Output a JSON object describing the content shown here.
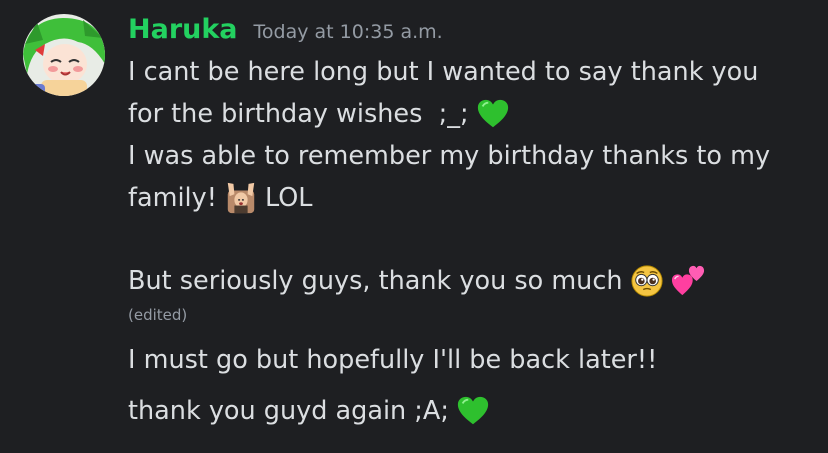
{
  "message": {
    "username": "Haruka",
    "username_color": "#23d160",
    "timestamp": "Today at 10:35 a.m.",
    "avatar_icon": "anime-avatar-green-hair",
    "lines": [
      {
        "text": "I cant be here long but I wanted to say thank you"
      },
      {
        "text": "for the birthday wishes  ;_;",
        "emoji": "green-heart-icon"
      },
      {
        "text": "I was able to remember my birthday thanks to my"
      },
      {
        "text_before": "family!",
        "emoji": "raised-hands-sticker-icon",
        "text_after": "LOL"
      },
      {
        "text": "But seriously guys, thank you so much",
        "emojis": [
          "pleading-face-icon",
          "two-hearts-icon"
        ]
      }
    ],
    "edited_label": "(edited)",
    "followups": [
      {
        "text": "I must go but hopefully I'll be back later!!"
      },
      {
        "text": "thank you guyd again ;A;",
        "emoji": "green-heart-icon"
      }
    ]
  },
  "colors": {
    "background": "#1e1f22",
    "text": "#dbdee1",
    "muted": "#949ba4"
  }
}
